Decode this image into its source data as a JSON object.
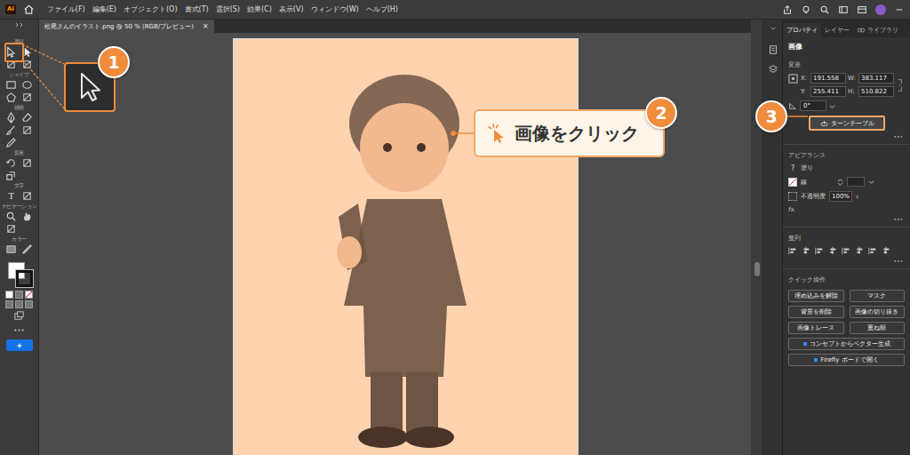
{
  "menubar": {
    "logo": "Ai",
    "menus": [
      "ファイル(F)",
      "編集(E)",
      "オブジェクト(O)",
      "書式(T)",
      "選択(S)",
      "効果(C)",
      "表示(V)",
      "ウィンドウ(W)",
      "ヘルプ(H)"
    ]
  },
  "document_tab": {
    "title": "松尾さんのイラスト.png @ 50 % (RGB/プレビュー)",
    "close": "×",
    "selected": true
  },
  "toolbar": {
    "sections": [
      {
        "label": "選択"
      },
      {
        "label": "シェイプ"
      },
      {
        "label": "描画"
      },
      {
        "label": "変更"
      },
      {
        "label": "文字"
      },
      {
        "label": "ナビゲーション"
      },
      {
        "label": "カラー"
      }
    ],
    "type_glyph": "T",
    "more": "•••"
  },
  "panel": {
    "tabs": [
      {
        "label": "プロパティ",
        "selected": true
      },
      {
        "label": "レイヤー",
        "selected": false
      },
      {
        "label": "ライブラリ",
        "selected": false
      }
    ],
    "object_type": "画像",
    "transform": {
      "title": "変形",
      "fields": [
        {
          "label": "X:",
          "value": "191.558"
        },
        {
          "label": "W:",
          "value": "383.117"
        },
        {
          "label": "Y:",
          "value": "255.411"
        },
        {
          "label": "H:",
          "value": "510.822"
        }
      ],
      "angle": "0°"
    },
    "turntable_button": "ターンテーブル",
    "more": "•••",
    "appearance": {
      "title": "アピアランス",
      "fill": {
        "icon": "?",
        "label": "塗り"
      },
      "stroke": {
        "label": "線"
      },
      "opacity": {
        "label": "不透明度",
        "value": "100%",
        "arrow": "›"
      },
      "fx": "fx."
    },
    "align": {
      "title": "整列"
    },
    "quick_actions": {
      "title": "クイック操作",
      "buttons": [
        {
          "label": "埋め込みを解除",
          "kind": "half"
        },
        {
          "label": "マスク",
          "kind": "half"
        },
        {
          "label": "背景を削除",
          "kind": "half"
        },
        {
          "label": "画像の切り抜き",
          "kind": "half"
        },
        {
          "label": "画像トレース",
          "kind": "half"
        },
        {
          "label": "重ね順",
          "kind": "half"
        },
        {
          "label": "コンセプトからベクター生成",
          "kind": "full"
        },
        {
          "label": "Firefly ボードで開く",
          "kind": "full"
        }
      ]
    }
  },
  "steps": [
    {
      "number": "1"
    },
    {
      "number": "2",
      "label": "画像をクリック"
    },
    {
      "number": "3"
    }
  ]
}
